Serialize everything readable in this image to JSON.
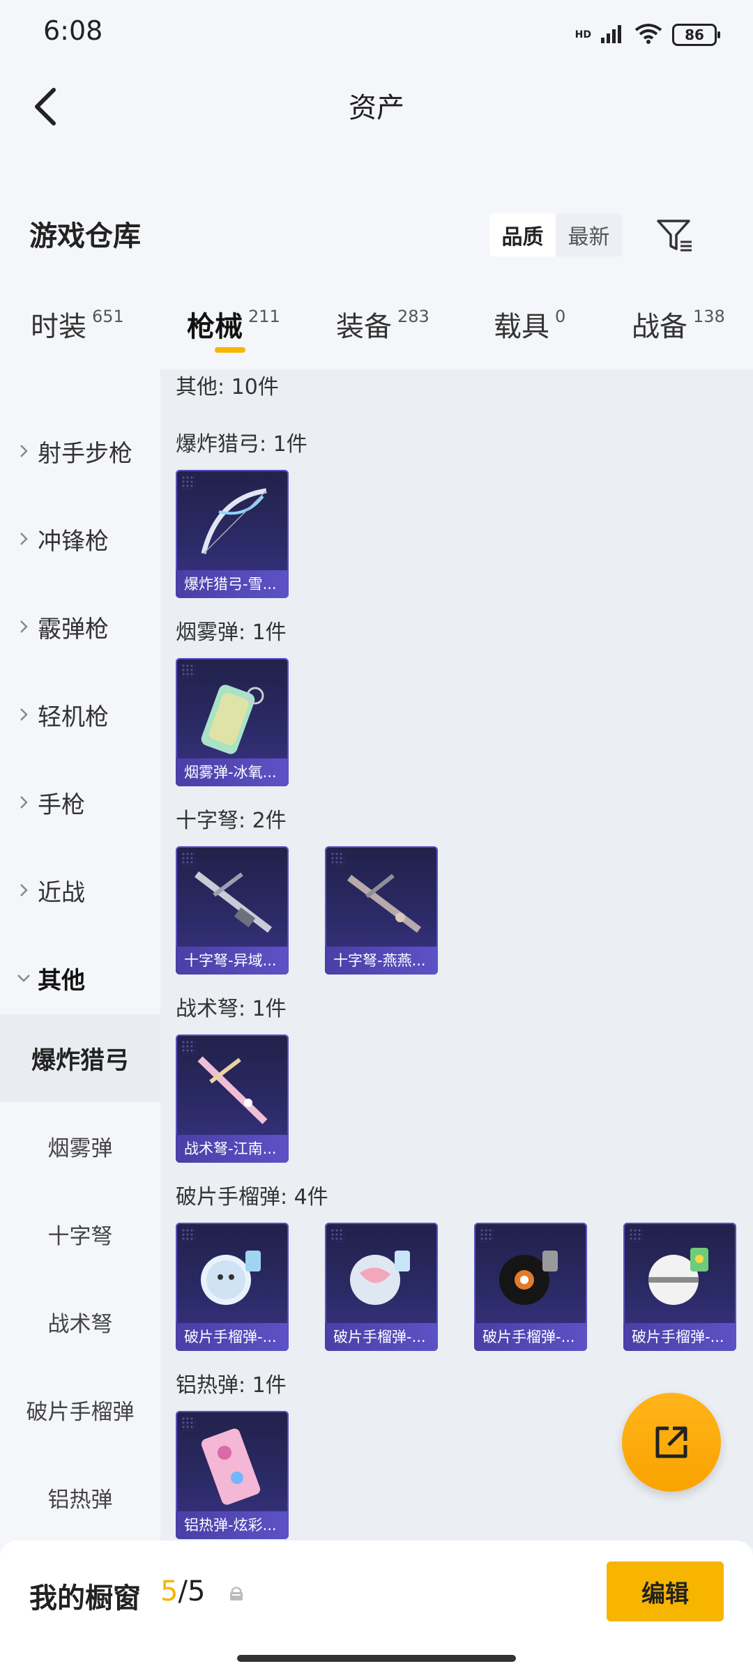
{
  "status_bar": {
    "time": "6:08",
    "network": "HD",
    "battery": "86"
  },
  "header": {
    "title": "资产"
  },
  "warehouse": {
    "title": "游戏仓库",
    "sort_options": [
      "品质",
      "最新"
    ],
    "active_sort": "品质"
  },
  "tabs": [
    {
      "label": "时装",
      "count": "651"
    },
    {
      "label": "枪械",
      "count": "211",
      "active": true
    },
    {
      "label": "装备",
      "count": "283"
    },
    {
      "label": "载具",
      "count": "0"
    },
    {
      "label": "战备",
      "count": "138"
    }
  ],
  "sidebar": {
    "categories": [
      "射手步枪",
      "冲锋枪",
      "霰弹枪",
      "轻机枪",
      "手枪",
      "近战",
      "其他"
    ],
    "subcategories": [
      "爆炸猎弓",
      "烟雾弹",
      "十字弩",
      "战术弩",
      "破片手榴弹",
      "铝热弹"
    ],
    "active_sub": "爆炸猎弓"
  },
  "content": {
    "summary": "其他: 10件",
    "groups": [
      {
        "title": "爆炸猎弓: 1件",
        "items": [
          "爆炸猎弓-雪..."
        ]
      },
      {
        "title": "烟雾弹: 1件",
        "items": [
          "烟雾弹-冰氧..."
        ]
      },
      {
        "title": "十字弩: 2件",
        "items": [
          "十字弩-异域...",
          "十字弩-燕燕..."
        ]
      },
      {
        "title": "战术弩: 1件",
        "items": [
          "战术弩-江南..."
        ]
      },
      {
        "title": "破片手榴弹: 4件",
        "items": [
          "破片手榴弹-...",
          "破片手榴弹-...",
          "破片手榴弹-...",
          "破片手榴弹-..."
        ]
      },
      {
        "title": "铝热弹: 1件",
        "items": [
          "铝热弹-炫彩..."
        ]
      }
    ]
  },
  "bottom_bar": {
    "label": "我的橱窗",
    "used": "5",
    "separator": "/",
    "total": "5",
    "edit_label": "编辑"
  },
  "colors": {
    "accent": "#f7b500",
    "card_bg": "#2b2a66",
    "card_label": "#5c52c6"
  }
}
